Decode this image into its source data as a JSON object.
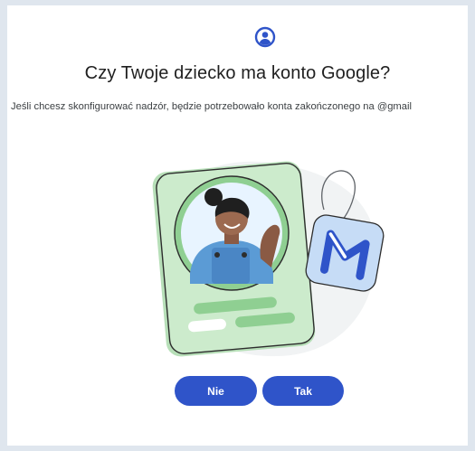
{
  "dialog": {
    "title": "Czy Twoje dziecko ma konto Google?",
    "subtitle": "Jeśli chcesz skonfigurować nadzór, będzie potrzebowało konta zakończonego na @gmail",
    "icon": "account-circle-icon",
    "illustration": "child-account-card-illustration"
  },
  "buttons": {
    "no_label": "Nie",
    "yes_label": "Tak"
  },
  "colors": {
    "accent": "#2f54c9",
    "card_green": "#ccebcc",
    "background": "#dfe6ee"
  }
}
